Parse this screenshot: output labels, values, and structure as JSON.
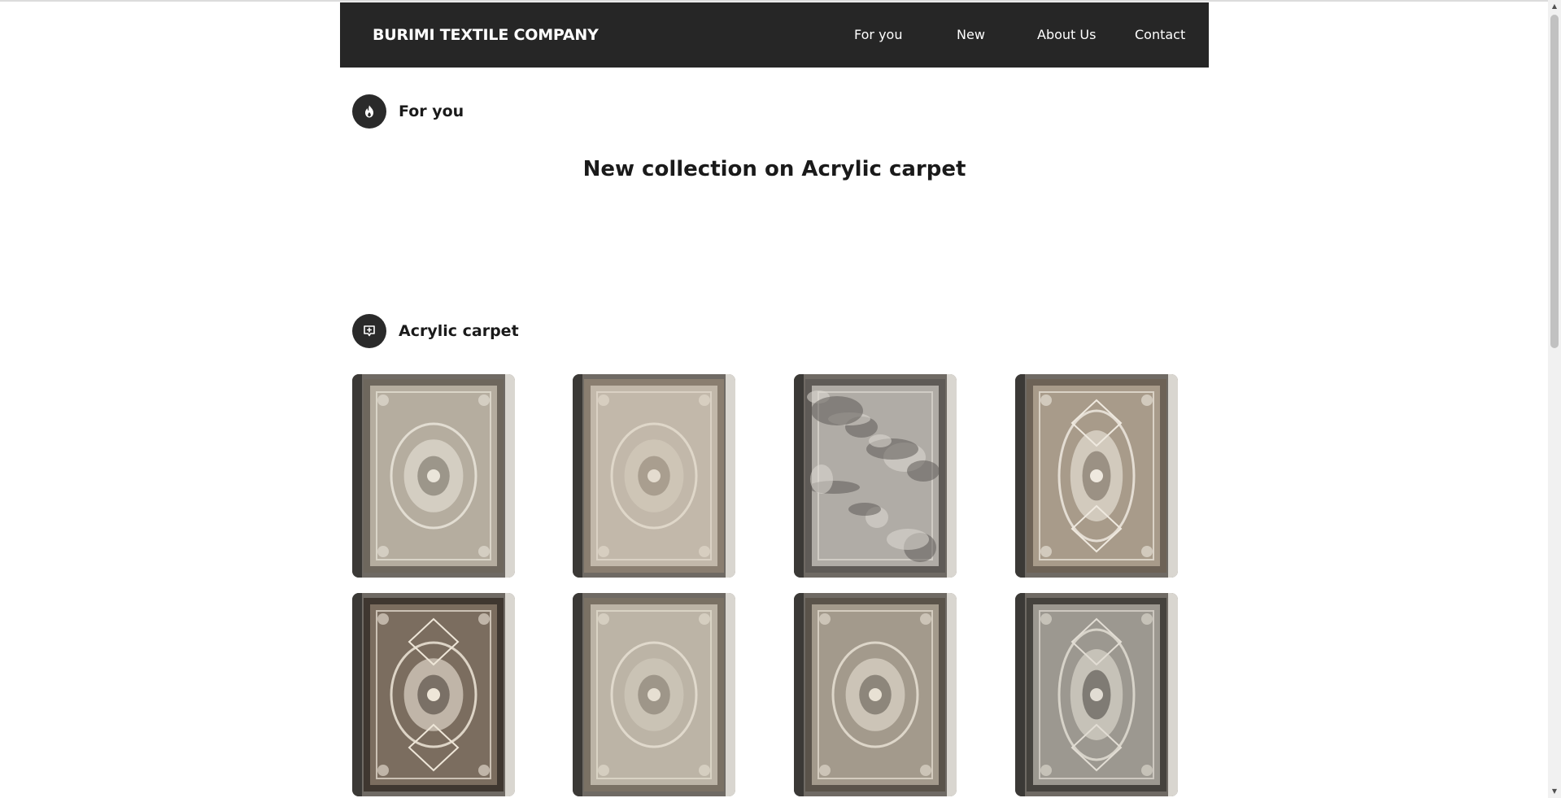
{
  "header": {
    "brand": "BURIMI TEXTILE COMPANY",
    "nav": [
      {
        "label": "For you"
      },
      {
        "label": "New"
      },
      {
        "label": "About Us"
      },
      {
        "label": "Contact"
      }
    ]
  },
  "for_you": {
    "title": "For you",
    "icon": "fire-icon",
    "headline": "New collection on Acrylic carpet"
  },
  "acrylic": {
    "title": "Acrylic carpet",
    "icon": "message-plus-icon",
    "products": [
      {
        "name": "carpet-1",
        "field": "#b5ad9f",
        "border": "#6e675d",
        "accent": "#eae5da",
        "style": "medallion-round"
      },
      {
        "name": "carpet-2",
        "field": "#c2b8aa",
        "border": "#8a7e70",
        "accent": "#e4dccf",
        "style": "medallion-faded"
      },
      {
        "name": "carpet-3",
        "field": "#b0aca6",
        "border": "#5f5b57",
        "accent": "#dedad3",
        "style": "distressed"
      },
      {
        "name": "carpet-4",
        "field": "#a89b8a",
        "border": "#6d6256",
        "accent": "#efe9df",
        "style": "medallion-frame"
      },
      {
        "name": "carpet-5",
        "field": "#7b6d5f",
        "border": "#3f3730",
        "accent": "#eee6d8",
        "style": "medallion-dark"
      },
      {
        "name": "carpet-6",
        "field": "#bcb4a6",
        "border": "#7a7164",
        "accent": "#e6dfd2",
        "style": "medallion-faded"
      },
      {
        "name": "carpet-7",
        "field": "#a39a8c",
        "border": "#5a534a",
        "accent": "#e8e1d4",
        "style": "medallion-round"
      },
      {
        "name": "carpet-8",
        "field": "#9c9890",
        "border": "#45423d",
        "accent": "#e2ddd4",
        "style": "medallion-frame"
      }
    ]
  },
  "colors": {
    "navbar_bg": "#262626",
    "icon_bg": "#2a2a2a",
    "text": "#1a1a1a"
  }
}
